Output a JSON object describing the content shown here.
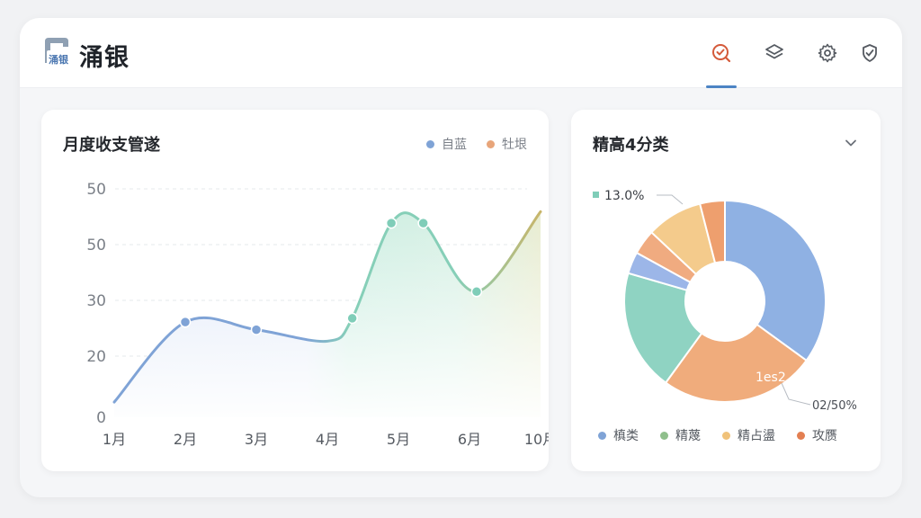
{
  "header": {
    "logo_text": "涌银",
    "brand": "涌银",
    "buttons": [
      {
        "name": "check-search",
        "icon": "check-search-icon",
        "active": true,
        "color": "#d45a3a"
      },
      {
        "name": "layers",
        "icon": "layers-icon",
        "active": false,
        "color": "#555a61"
      },
      {
        "name": "settings",
        "icon": "gear-icon",
        "active": false,
        "color": "#555a61"
      },
      {
        "name": "verified",
        "icon": "shield-check-icon",
        "active": false,
        "color": "#555a61"
      }
    ]
  },
  "line_card": {
    "title": "月度收支管遂",
    "legend": [
      {
        "label": "自蓝",
        "color": "#7fa3d6"
      },
      {
        "label": "牡垠",
        "color": "#e8a57a"
      }
    ]
  },
  "donut_card": {
    "title": "精高4分类",
    "callout_top": "13.0%",
    "callout_inner": "1es2",
    "callout_bottom": "02/50%",
    "legend": [
      {
        "label": "槙类",
        "color": "#7fa3d6"
      },
      {
        "label": "精蔑",
        "color": "#8fbf8c"
      },
      {
        "label": "精占盪",
        "color": "#f0c27a"
      },
      {
        "label": "攻赝",
        "color": "#e37f52"
      }
    ]
  },
  "chart_data": [
    {
      "type": "area",
      "title": "月度收支管遂",
      "y_ticks": [
        "50",
        "50",
        "30",
        "20",
        "0"
      ],
      "categories": [
        "1月",
        "2月",
        "3月",
        "4月",
        "5月",
        "6月",
        "10月"
      ],
      "series": [
        {
          "name": "自蓝",
          "points": [
            [
              0,
              4
            ],
            [
              1,
              25
            ],
            [
              2,
              23
            ],
            [
              3,
              20
            ],
            [
              3.35,
              26
            ],
            [
              3.9,
              51
            ],
            [
              4.35,
              51
            ],
            [
              5.1,
              33
            ],
            [
              6.0,
              54
            ]
          ],
          "markers": [
            [
              1,
              25
            ],
            [
              2,
              23
            ],
            [
              3.35,
              26
            ],
            [
              3.9,
              51
            ],
            [
              4.35,
              51
            ],
            [
              5.1,
              33
            ]
          ]
        }
      ],
      "ylim": [
        0,
        60
      ],
      "grid": true
    },
    {
      "type": "pie",
      "title": "精高4分类",
      "donut": true,
      "slices": [
        {
          "value": 35.0,
          "color": "#8fb1e3"
        },
        {
          "value": 25.0,
          "color": "#f0ac7c"
        },
        {
          "value": 19.5,
          "color": "#8fd3c2"
        },
        {
          "value": 3.5,
          "color": "#9cb6e8"
        },
        {
          "value": 4.0,
          "color": "#f0ab80"
        },
        {
          "value": 9.0,
          "color": "#f4cb8c"
        },
        {
          "value": 4.0,
          "color": "#ee9f6e"
        }
      ]
    }
  ]
}
